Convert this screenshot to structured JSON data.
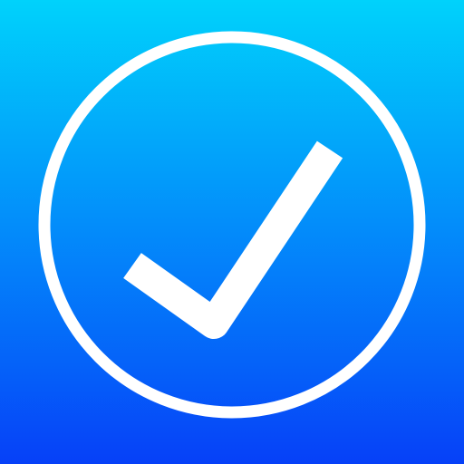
{
  "icon": {
    "name": "checkmark-circle-icon",
    "colors": {
      "gradient_top": "#00D2FB",
      "gradient_bottom": "#0640F8",
      "foreground": "#FFFFFF"
    }
  }
}
